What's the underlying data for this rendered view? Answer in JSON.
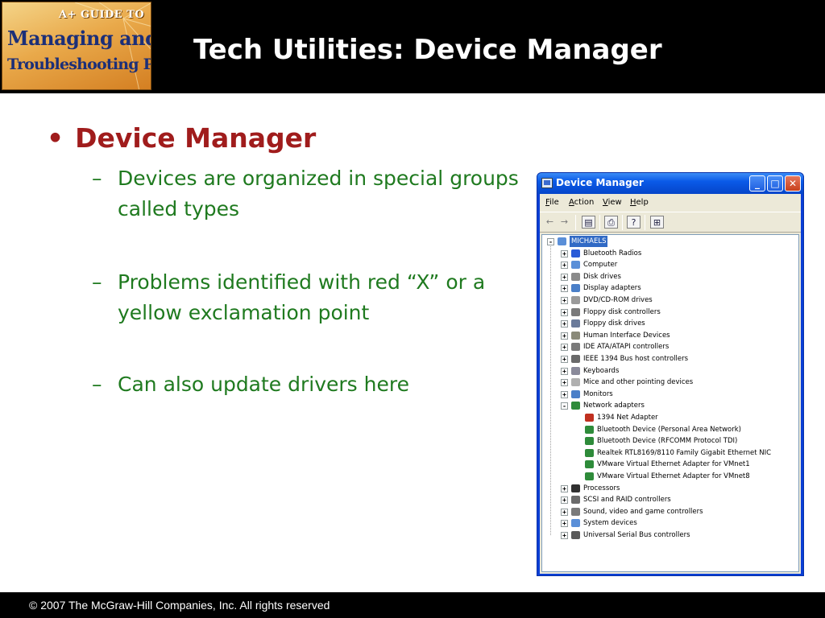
{
  "header": {
    "logo": {
      "line1": "A+ GUIDE TO",
      "line2": "Managing and",
      "line3": "Troubleshooting PCs"
    },
    "title": "Tech Utilities: Device Manager"
  },
  "content": {
    "main_bullet": "Device Manager",
    "sub_bullets": [
      "Devices are organized in special groups called types",
      "Problems identified with red “X” or a yellow exclamation point",
      "Can also update drivers here"
    ]
  },
  "device_manager": {
    "title": "Device Manager",
    "menu": [
      "File",
      "Action",
      "View",
      "Help"
    ],
    "root": "MICHAELS",
    "categories": [
      {
        "label": "Bluetooth Radios",
        "icon": "bluetooth-icon",
        "color": "#2a5bd7"
      },
      {
        "label": "Computer",
        "icon": "computer-icon",
        "color": "#5a8fd8"
      },
      {
        "label": "Disk drives",
        "icon": "disk-drive-icon",
        "color": "#8a8a8a"
      },
      {
        "label": "Display adapters",
        "icon": "display-adapter-icon",
        "color": "#4a7fc8"
      },
      {
        "label": "DVD/CD-ROM drives",
        "icon": "dvd-drive-icon",
        "color": "#9a9a9a"
      },
      {
        "label": "Floppy disk controllers",
        "icon": "floppy-controller-icon",
        "color": "#7a7a7a"
      },
      {
        "label": "Floppy disk drives",
        "icon": "floppy-drive-icon",
        "color": "#6a7a9a"
      },
      {
        "label": "Human Interface Devices",
        "icon": "hid-icon",
        "color": "#8a8a7a"
      },
      {
        "label": "IDE ATA/ATAPI controllers",
        "icon": "ide-controller-icon",
        "color": "#7a7a7a"
      },
      {
        "label": "IEEE 1394 Bus host controllers",
        "icon": "ieee1394-icon",
        "color": "#6a6a6a"
      },
      {
        "label": "Keyboards",
        "icon": "keyboard-icon",
        "color": "#8a8a9a"
      },
      {
        "label": "Mice and other pointing devices",
        "icon": "mouse-icon",
        "color": "#b0b0b0"
      },
      {
        "label": "Monitors",
        "icon": "monitor-icon",
        "color": "#4a7fc8"
      },
      {
        "label": "Network adapters",
        "icon": "network-adapter-icon",
        "color": "#2e8b3a",
        "expanded": true,
        "children": [
          {
            "label": "1394 Net Adapter",
            "icon": "network-card-icon",
            "color": "#c03020"
          },
          {
            "label": "Bluetooth Device (Personal Area Network)",
            "icon": "network-card-icon",
            "color": "#2e8b3a"
          },
          {
            "label": "Bluetooth Device (RFCOMM Protocol TDI)",
            "icon": "network-card-icon",
            "color": "#2e8b3a"
          },
          {
            "label": "Realtek RTL8169/8110 Family Gigabit Ethernet NIC",
            "icon": "network-card-icon",
            "color": "#2e8b3a"
          },
          {
            "label": "VMware Virtual Ethernet Adapter for VMnet1",
            "icon": "network-card-icon",
            "color": "#2e8b3a"
          },
          {
            "label": "VMware Virtual Ethernet Adapter for VMnet8",
            "icon": "network-card-icon",
            "color": "#2e8b3a"
          }
        ]
      },
      {
        "label": "Processors",
        "icon": "processor-icon",
        "color": "#303030"
      },
      {
        "label": "SCSI and RAID controllers",
        "icon": "scsi-controller-icon",
        "color": "#6a6a6a"
      },
      {
        "label": "Sound, video and game controllers",
        "icon": "sound-icon",
        "color": "#7a7a7a"
      },
      {
        "label": "System devices",
        "icon": "system-devices-icon",
        "color": "#5a8fd8"
      },
      {
        "label": "Universal Serial Bus controllers",
        "icon": "usb-icon",
        "color": "#5a5a5a"
      }
    ]
  },
  "footer": {
    "copyright": "© 2007 The McGraw-Hill Companies, Inc. All rights reserved"
  }
}
